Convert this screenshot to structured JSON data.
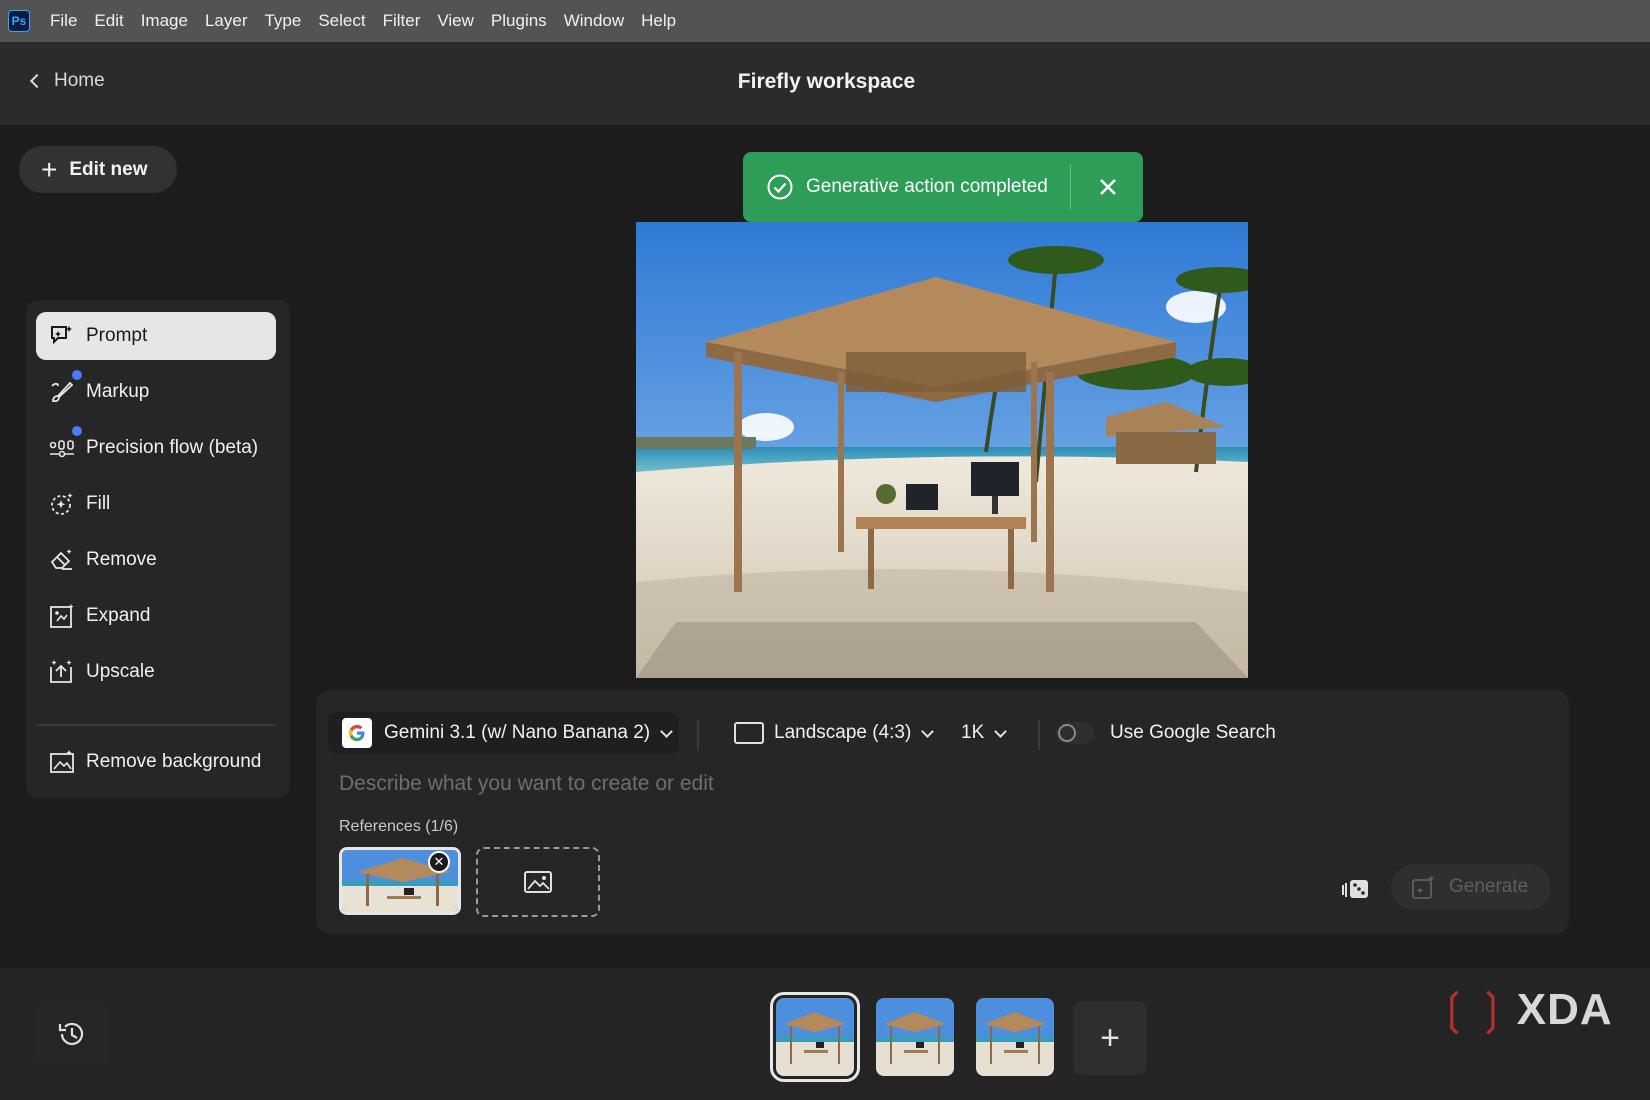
{
  "menubar": {
    "app_logo": "Ps",
    "items": [
      "File",
      "Edit",
      "Image",
      "Layer",
      "Type",
      "Select",
      "Filter",
      "View",
      "Plugins",
      "Window",
      "Help"
    ]
  },
  "header": {
    "back_label": "Home",
    "title": "Firefly workspace"
  },
  "edit_new_label": "Edit new",
  "tools": [
    {
      "label": "Prompt",
      "icon": "prompt-icon",
      "active": true,
      "new_dot": false
    },
    {
      "label": "Markup",
      "icon": "markup-brush-icon",
      "active": false,
      "new_dot": true
    },
    {
      "label": "Precision flow (beta)",
      "icon": "precision-flow-icon",
      "active": false,
      "new_dot": true
    },
    {
      "label": "Fill",
      "icon": "fill-icon",
      "active": false,
      "new_dot": false
    },
    {
      "label": "Remove",
      "icon": "eraser-icon",
      "active": false,
      "new_dot": false
    },
    {
      "label": "Expand",
      "icon": "expand-icon",
      "active": false,
      "new_dot": false
    },
    {
      "label": "Upscale",
      "icon": "upscale-icon",
      "active": false,
      "new_dot": false
    },
    {
      "label": "Remove background",
      "icon": "remove-background-icon",
      "active": false,
      "new_dot": false
    }
  ],
  "toast": {
    "message": "Generative action completed",
    "color": "#2d9d58"
  },
  "prompt_panel": {
    "model": "Gemini 3.1 (w/ Nano Banana 2)",
    "aspect_ratio": "Landscape (4:3)",
    "resolution": "1K",
    "google_search_label": "Use Google Search",
    "google_search_enabled": false,
    "placeholder": "Describe what you want to create or edit",
    "references_label": "References (1/6)",
    "generate_label": "Generate"
  },
  "variations": {
    "count": 3,
    "selected_index": 0
  },
  "watermark": "XDA",
  "colors": {
    "accent_blue": "#4e7bf7",
    "success_green": "#2d9d58",
    "menubar": "#535353",
    "background": "#1c1c1c"
  }
}
